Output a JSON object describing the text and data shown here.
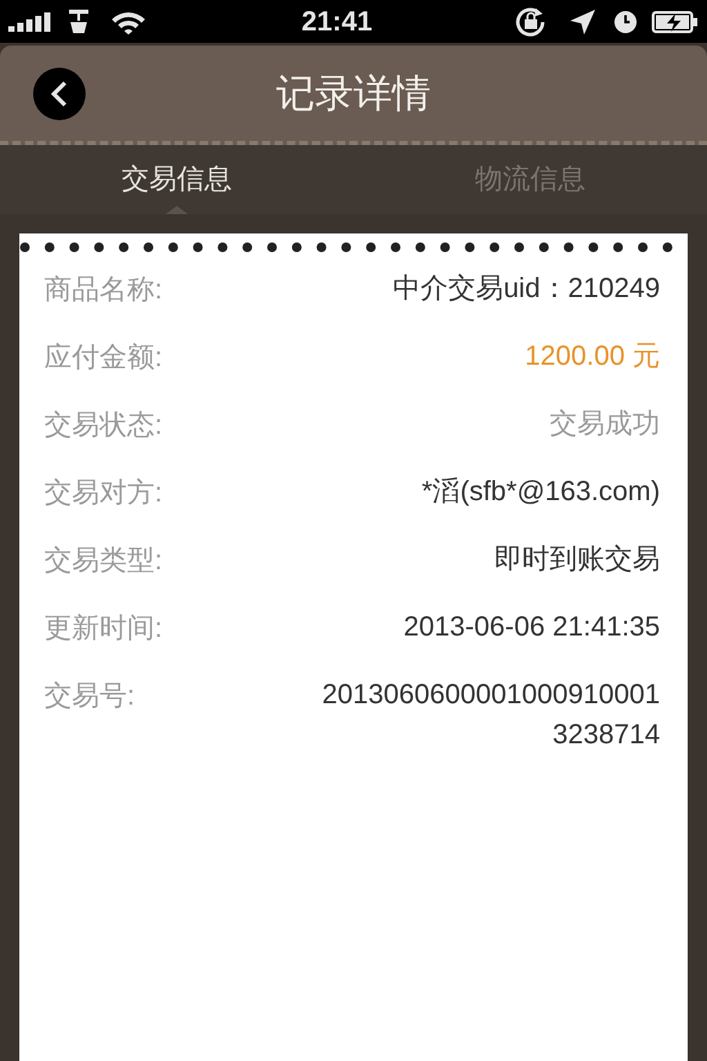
{
  "status_bar": {
    "time": "21:41"
  },
  "nav": {
    "title": "记录详情"
  },
  "tabs": [
    {
      "label": "交易信息",
      "selected": true
    },
    {
      "label": "物流信息",
      "selected": false
    }
  ],
  "details": [
    {
      "label": "商品名称:",
      "value": "中介交易uid：210249",
      "kind": "normal"
    },
    {
      "label": "应付金额:",
      "value": "1200.00 元",
      "kind": "amount"
    },
    {
      "label": "交易状态:",
      "value": "交易成功",
      "kind": "status"
    },
    {
      "label": "交易对方:",
      "value": "*滔(sfb*@163.com)",
      "kind": "normal"
    },
    {
      "label": "交易类型:",
      "value": "即时到账交易",
      "kind": "normal"
    },
    {
      "label": "更新时间:",
      "value": "2013-06-06 21:41:35",
      "kind": "normal"
    },
    {
      "label": "交易号:",
      "value": "20130606000010009100013238714",
      "kind": "normal"
    }
  ]
}
